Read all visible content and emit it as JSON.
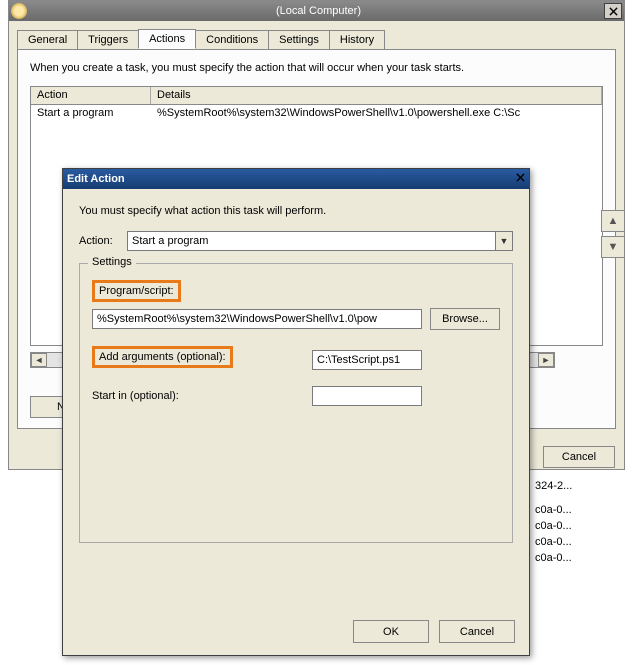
{
  "main": {
    "title": "(Local Computer)",
    "tabs": {
      "general": "General",
      "triggers": "Triggers",
      "actions": "Actions",
      "conditions": "Conditions",
      "settings": "Settings",
      "history": "History"
    },
    "description": "When you create a task, you must specify the action that will occur when your task starts.",
    "columns": {
      "action": "Action",
      "details": "Details"
    },
    "row": {
      "action": "Start a program",
      "details": "%SystemRoot%\\system32\\WindowsPowerShell\\v1.0\\powershell.exe C:\\Sc"
    },
    "buttons": {
      "new": "Ne"
    },
    "footer": {
      "cancel": "Cancel"
    }
  },
  "dialog": {
    "title": "Edit Action",
    "description": "You must specify what action this task will perform.",
    "action_label": "Action:",
    "action_value": "Start a program",
    "group_legend": "Settings",
    "program_label": "Program/script:",
    "program_value": "%SystemRoot%\\system32\\WindowsPowerShell\\v1.0\\pow",
    "browse_label": "Browse...",
    "args_label": "Add arguments (optional):",
    "args_value": "C:\\TestScript.ps1",
    "startin_label": "Start in (optional):",
    "startin_value": "",
    "ok": "OK",
    "cancel": "Cancel"
  },
  "bg_list": [
    "324-2...",
    "c0a-0...",
    "c0a-0...",
    "c0a-0...",
    "c0a-0..."
  ]
}
